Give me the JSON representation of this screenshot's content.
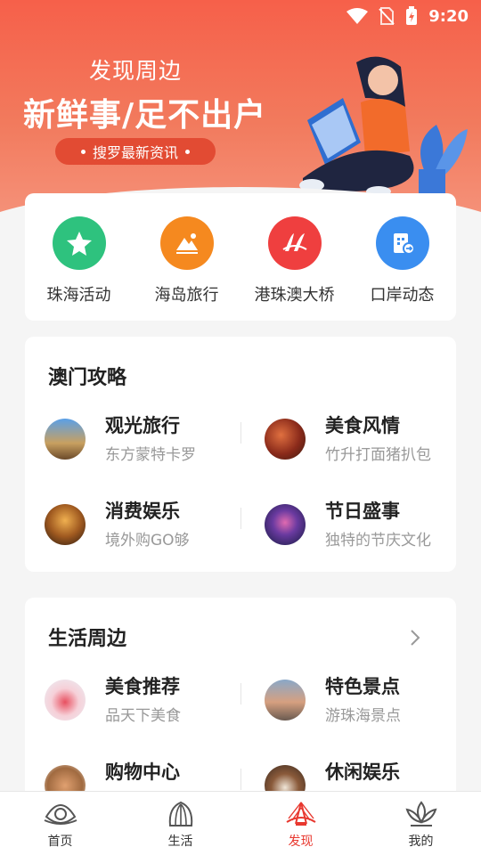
{
  "status_bar": {
    "time": "9:20"
  },
  "hero": {
    "subtitle": "发现周边",
    "title": "新鲜事/足不出户",
    "pill": "搜罗最新资讯"
  },
  "quick_links": [
    {
      "label": "珠海活动",
      "icon": "star-icon",
      "color": "#2ec27e"
    },
    {
      "label": "海岛旅行",
      "icon": "mountain-icon",
      "color": "#f5891f"
    },
    {
      "label": "港珠澳大桥",
      "icon": "bridge-logo-icon",
      "color": "#ef3f3f"
    },
    {
      "label": "口岸动态",
      "icon": "document-arrow-icon",
      "color": "#3a8ef0"
    }
  ],
  "macau_guide": {
    "title": "澳门攻略",
    "items": [
      {
        "title": "观光旅行",
        "subtitle": "东方蒙特卡罗"
      },
      {
        "title": "美食风情",
        "subtitle": "竹升打面猪扒包"
      },
      {
        "title": "消费娱乐",
        "subtitle": "境外购GO够"
      },
      {
        "title": "节日盛事",
        "subtitle": "独特的节庆文化"
      }
    ]
  },
  "life_nearby": {
    "title": "生活周边",
    "items": [
      {
        "title": "美食推荐",
        "subtitle": "品天下美食"
      },
      {
        "title": "特色景点",
        "subtitle": "游珠海景点"
      },
      {
        "title": "购物中心",
        "subtitle": ""
      },
      {
        "title": "休闲娱乐",
        "subtitle": ""
      }
    ]
  },
  "tabbar": [
    {
      "label": "首页",
      "active": false
    },
    {
      "label": "生活",
      "active": false
    },
    {
      "label": "发现",
      "active": true
    },
    {
      "label": "我的",
      "active": false
    }
  ],
  "colors": {
    "brand": "#f4644b",
    "active_tab": "#e8382f"
  }
}
